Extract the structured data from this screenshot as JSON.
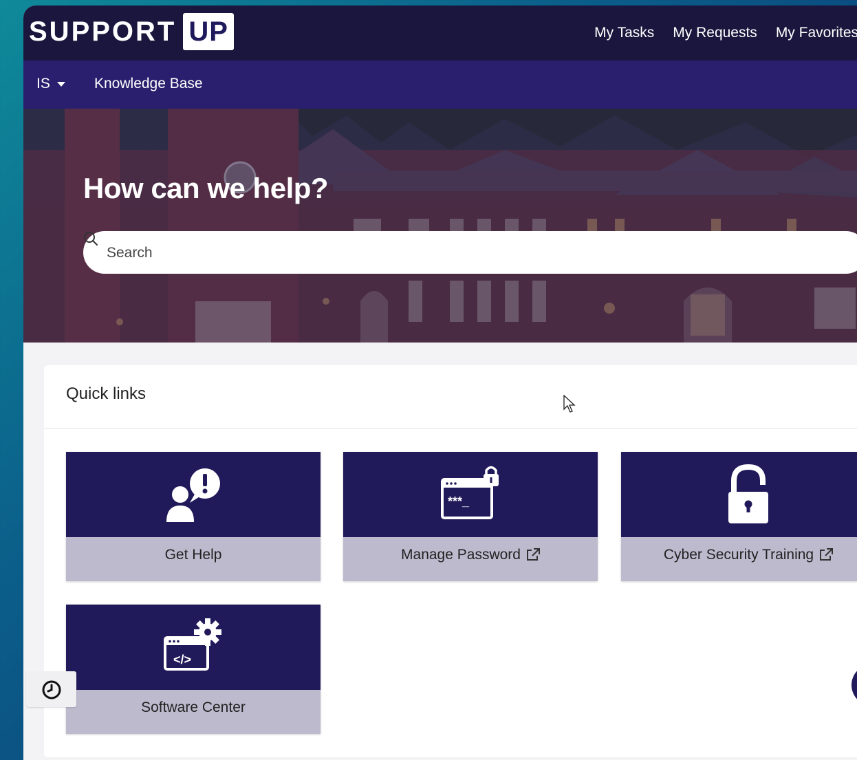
{
  "header": {
    "logo_text": "SUPPORT",
    "logo_box": "UP",
    "links": [
      "My Tasks",
      "My Requests",
      "My Favorites"
    ]
  },
  "subnav": {
    "dropdown_label": "IS",
    "knowledge_base": "Knowledge Base"
  },
  "hero": {
    "title": "How can we help?",
    "search_placeholder": "Search"
  },
  "quick_links": {
    "title": "Quick links",
    "cards": [
      {
        "label": "Get Help",
        "icon": "person-alert-icon",
        "external": false
      },
      {
        "label": "Manage Password",
        "icon": "password-lock-icon",
        "external": true
      },
      {
        "label": "Cyber Security Training",
        "icon": "padlock-icon",
        "external": true
      },
      {
        "label": "Software Center",
        "icon": "code-gear-icon",
        "external": false
      }
    ]
  },
  "floating": {
    "history_icon": "clock-icon"
  },
  "colors": {
    "topbar": "#1a163d",
    "subnav": "#2a1f6e",
    "card_top": "#211a5a",
    "card_bottom": "#bdbace"
  }
}
